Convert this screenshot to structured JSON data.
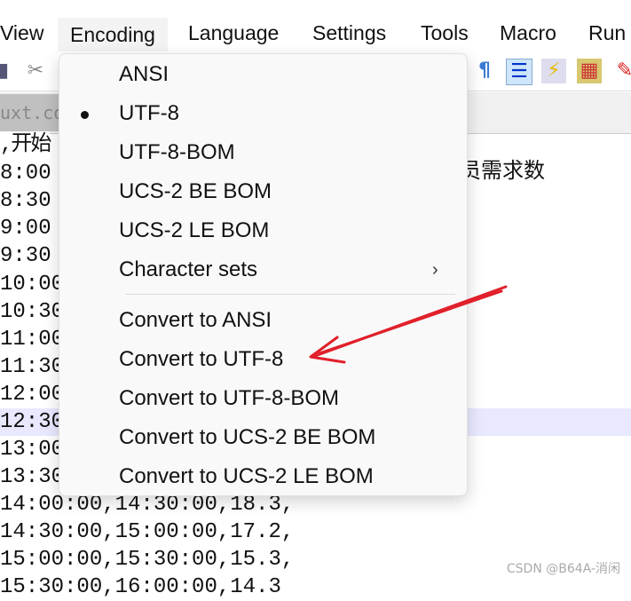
{
  "menubar": {
    "items": [
      "View",
      "Encoding",
      "Language",
      "Settings",
      "Tools",
      "Macro",
      "Run"
    ],
    "active": "Encoding"
  },
  "toolbar": {
    "icons": [
      "save-icon",
      "cut-icon",
      "pilcrow-icon",
      "indent-guide-icon",
      "lightning-icon",
      "map-icon",
      "pen-icon"
    ]
  },
  "tab": {
    "label": "uxt.co"
  },
  "editor": {
    "header_left": ",开始",
    "header_right": "员需求数",
    "lines": [
      "8:00",
      "8:30",
      "9:00",
      "9:30",
      "10:00",
      "10:30",
      "11:00",
      "11:30",
      "12:00",
      "12:30",
      "13:00",
      "13:30",
      "14:00:00,14:30:00,18.3,",
      "14:30:00,15:00:00,17.2,",
      "15:00:00,15:30:00,15.3,",
      "15:30:00,16:00:00,14.3"
    ],
    "current_line": "12:30"
  },
  "encoding_menu": {
    "items": [
      {
        "label": "ANSI"
      },
      {
        "label": "UTF-8",
        "checked": true
      },
      {
        "label": "UTF-8-BOM"
      },
      {
        "label": "UCS-2 BE BOM"
      },
      {
        "label": "UCS-2 LE BOM"
      },
      {
        "label": "Character sets",
        "submenu": true,
        "chevron": "›"
      }
    ],
    "convert_items": [
      {
        "label": "Convert to ANSI"
      },
      {
        "label": "Convert to UTF-8"
      },
      {
        "label": "Convert to UTF-8-BOM"
      },
      {
        "label": "Convert to UCS-2 BE BOM"
      },
      {
        "label": "Convert to UCS-2 LE BOM"
      }
    ]
  },
  "annotation": {
    "color": "#e0202a",
    "target": "Convert to UTF-8"
  },
  "watermark": "CSDN @B64A-消闲"
}
